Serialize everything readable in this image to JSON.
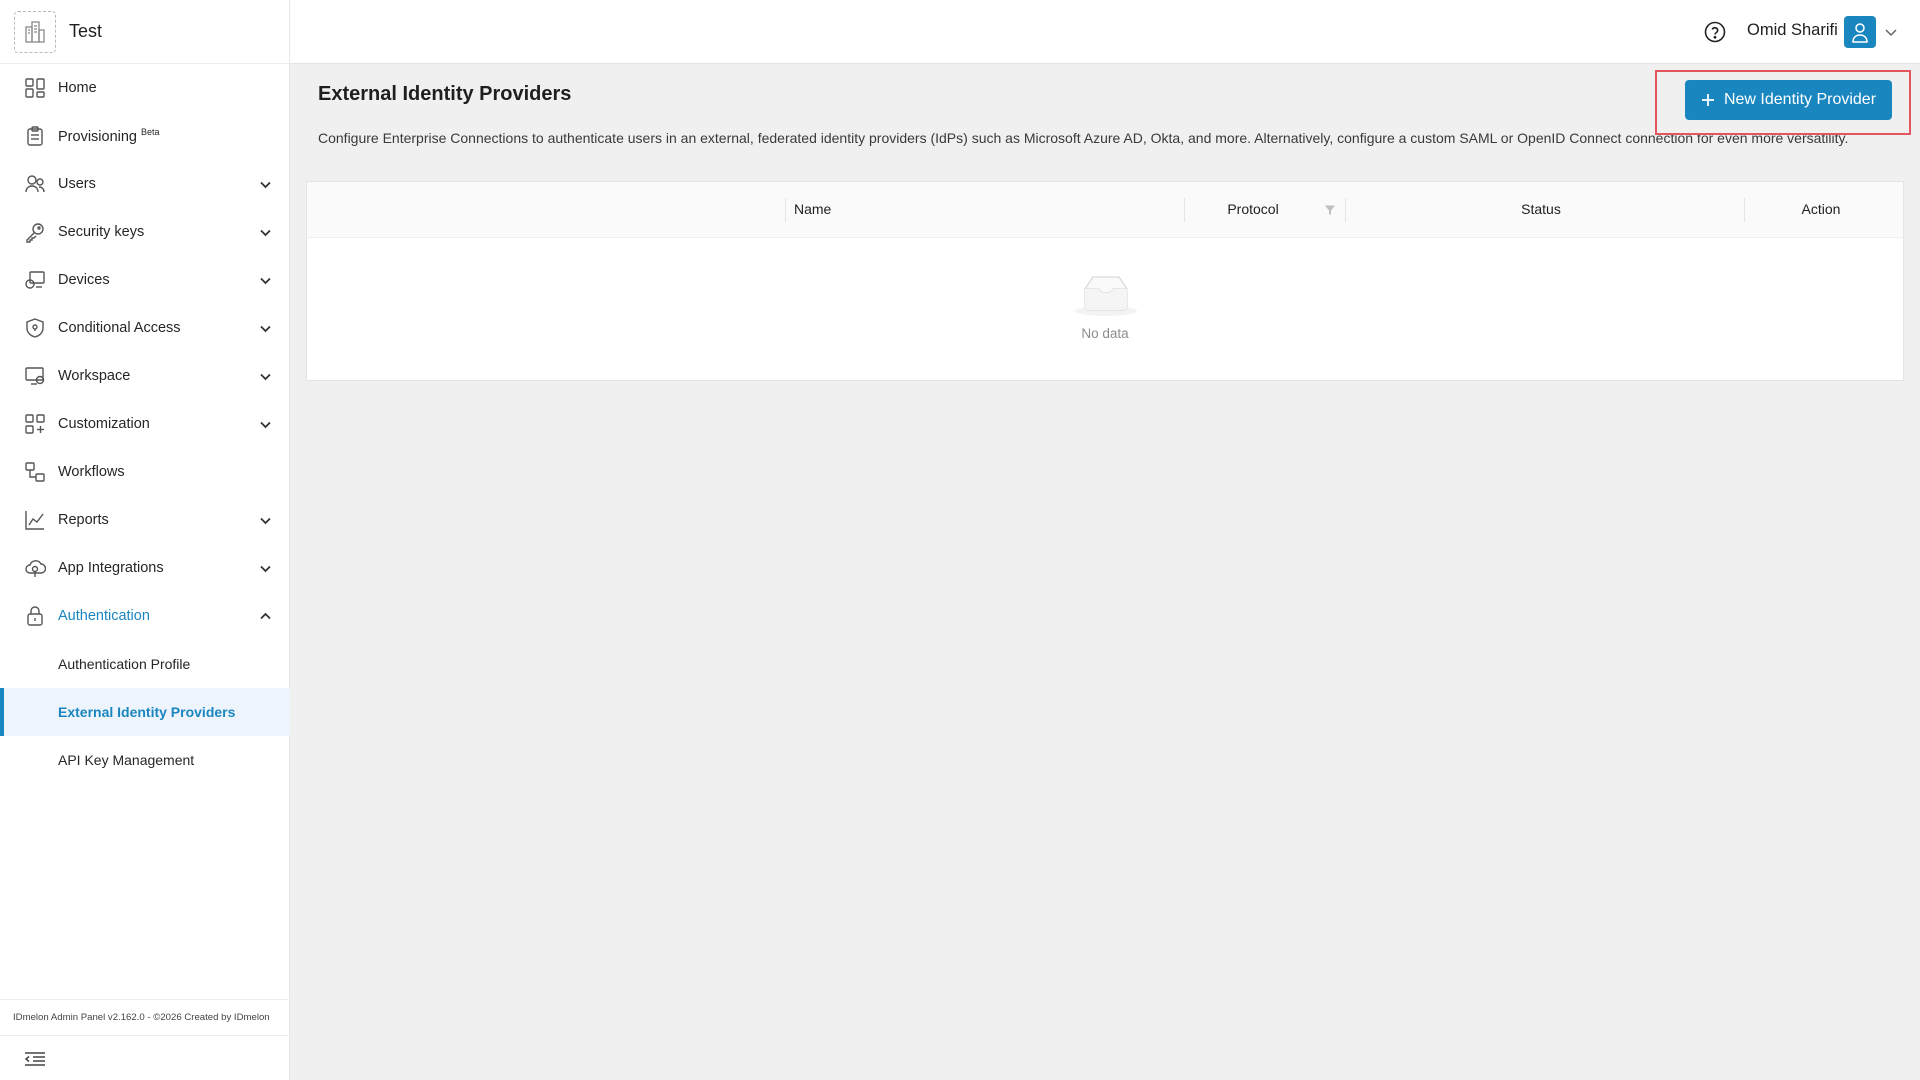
{
  "sidebar": {
    "org_name": "Test",
    "items": [
      {
        "label": "Home",
        "icon": "home-icon",
        "expandable": false
      },
      {
        "label": "Provisioning",
        "badge": "Beta",
        "icon": "clipboard-icon",
        "expandable": false
      },
      {
        "label": "Users",
        "icon": "users-icon",
        "expandable": true
      },
      {
        "label": "Security keys",
        "icon": "key-icon",
        "expandable": true
      },
      {
        "label": "Devices",
        "icon": "devices-icon",
        "expandable": true
      },
      {
        "label": "Conditional Access",
        "icon": "shield-icon",
        "expandable": true
      },
      {
        "label": "Workspace",
        "icon": "workspace-icon",
        "expandable": true
      },
      {
        "label": "Customization",
        "icon": "customization-icon",
        "expandable": true
      },
      {
        "label": "Workflows",
        "icon": "workflow-icon",
        "expandable": false
      },
      {
        "label": "Reports",
        "icon": "chart-icon",
        "expandable": true
      },
      {
        "label": "App Integrations",
        "icon": "cloud-icon",
        "expandable": true
      },
      {
        "label": "Authentication",
        "icon": "lock-icon",
        "expandable": true,
        "expanded": true
      }
    ],
    "sub_items": [
      {
        "label": "Authentication Profile",
        "active": false
      },
      {
        "label": "External Identity Providers",
        "active": true
      },
      {
        "label": "API Key Management",
        "active": false
      }
    ],
    "footer": "IDmelon Admin Panel v2.162.0 - ©2026 Created by IDmelon"
  },
  "header": {
    "user_name": "Omid Sharifi"
  },
  "main": {
    "title": "External Identity Providers",
    "description": "Configure Enterprise Connections to authenticate users in an external, federated identity providers (IdPs) such as Microsoft Azure AD, Okta, and more. Alternatively, configure a custom SAML or OpenID Connect connection for even more versatility.",
    "new_button_label": "New Identity Provider",
    "table": {
      "columns": [
        "Name",
        "Protocol",
        "Status",
        "Action"
      ],
      "rows": [],
      "empty_text": "No data"
    }
  },
  "colors": {
    "accent": "#1a86c0",
    "active_bg": "#eef4fb",
    "highlight_box": "#e4565e",
    "canvas": "#f0f0f0"
  }
}
